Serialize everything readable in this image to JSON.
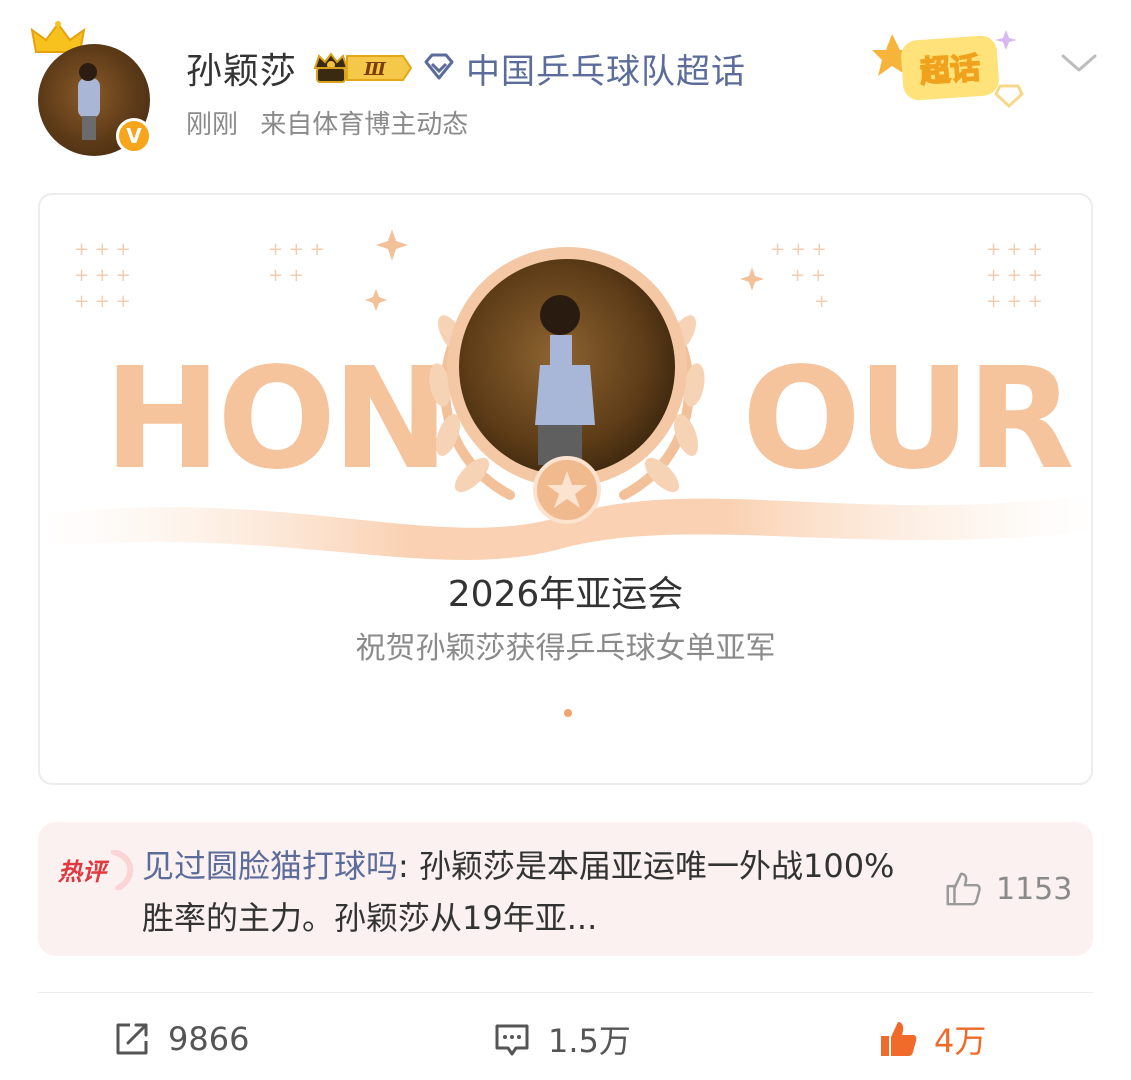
{
  "post": {
    "username": "孙颖莎",
    "vip_level": "Ⅲ",
    "topic": "中国乒乓球队超话",
    "time": "刚刚",
    "source": "来自体育博主动态",
    "supertopic_sticker": "超话",
    "verified_mark": "V"
  },
  "card": {
    "banner_left": "HON",
    "banner_right": "OUR",
    "title": "2026年亚运会",
    "subtitle": "祝贺孙颖莎获得乒乓球女单亚军"
  },
  "hot_comment": {
    "label": "热评",
    "author": "见过圆脸猫打球吗",
    "text": ": 孙颖莎是本届亚运唯一外战100%胜率的主力。孙颖莎从19年亚...",
    "likes": "1153"
  },
  "actions": {
    "share_count": "9866",
    "comment_count": "1.5万",
    "like_count": "4万"
  },
  "colors": {
    "link": "#5b6c9b",
    "accent_orange": "#f06a2a",
    "honour_peach": "#f5c39c",
    "hot_bg": "#fcf1f1"
  }
}
